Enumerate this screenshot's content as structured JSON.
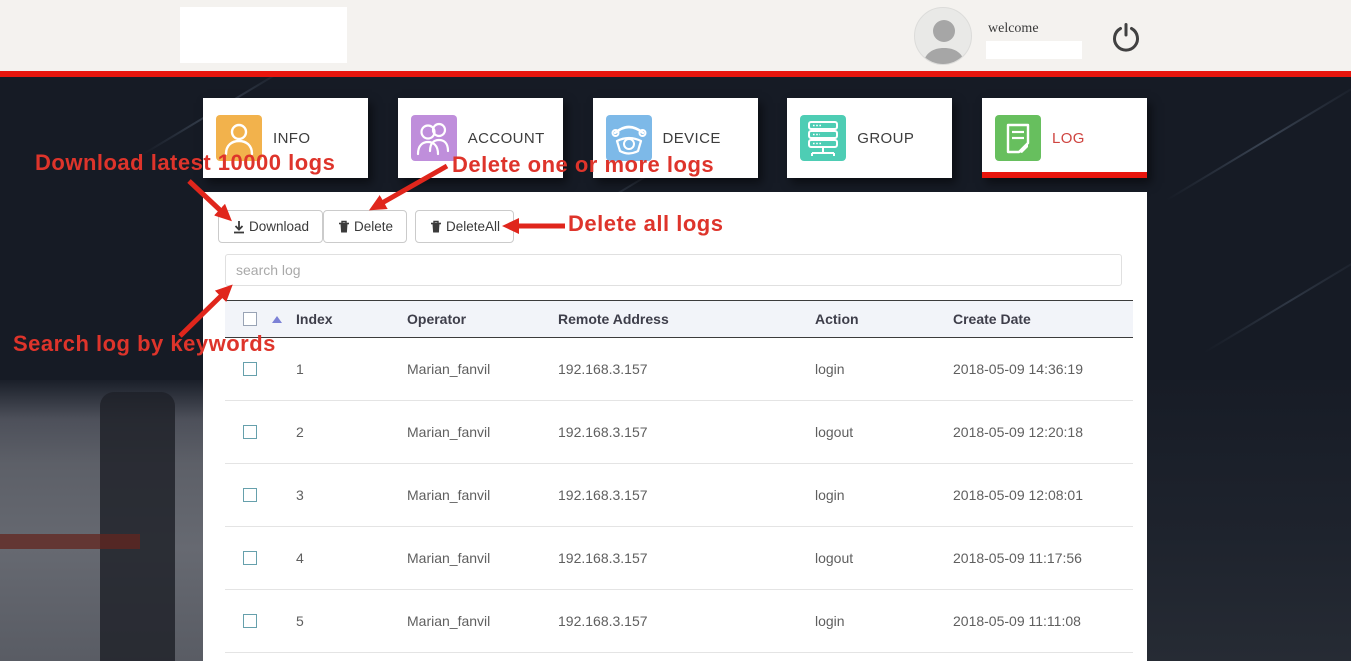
{
  "header": {
    "welcome": "welcome"
  },
  "tabs": [
    {
      "label": "INFO",
      "icon": "person-icon",
      "icon_color": "#f2b24c",
      "active": false
    },
    {
      "label": "ACCOUNT",
      "icon": "people-icon",
      "icon_color": "#bf8edb",
      "active": false
    },
    {
      "label": "DEVICE",
      "icon": "phone-icon",
      "icon_color": "#7db9e8",
      "active": false
    },
    {
      "label": "GROUP",
      "icon": "servers-icon",
      "icon_color": "#4ecdb4",
      "active": false
    },
    {
      "label": "LOG",
      "icon": "document-icon",
      "icon_color": "#67bf5e",
      "active": true
    }
  ],
  "toolbar": {
    "download": "Download",
    "delete": "Delete",
    "delete_all": "DeleteAll",
    "download_icon": "download-icon",
    "delete_icon": "trash-icon",
    "delete_all_icon": "trash-icon"
  },
  "search": {
    "placeholder": "search log"
  },
  "table": {
    "columns": [
      "Index",
      "Operator",
      "Remote Address",
      "Action",
      "Create Date"
    ],
    "rows": [
      {
        "index": "1",
        "operator": "Marian_fanvil",
        "remote_address": "192.168.3.157",
        "action": "login",
        "create_date": "2018-05-09 14:36:19"
      },
      {
        "index": "2",
        "operator": "Marian_fanvil",
        "remote_address": "192.168.3.157",
        "action": "logout",
        "create_date": "2018-05-09 12:20:18"
      },
      {
        "index": "3",
        "operator": "Marian_fanvil",
        "remote_address": "192.168.3.157",
        "action": "login",
        "create_date": "2018-05-09 12:08:01"
      },
      {
        "index": "4",
        "operator": "Marian_fanvil",
        "remote_address": "192.168.3.157",
        "action": "logout",
        "create_date": "2018-05-09 11:17:56"
      },
      {
        "index": "5",
        "operator": "Marian_fanvil",
        "remote_address": "192.168.3.157",
        "action": "login",
        "create_date": "2018-05-09 11:11:08"
      }
    ]
  },
  "annotations": {
    "download": "Download latest 10000 logs",
    "delete": "Delete one or more logs",
    "delete_all": "Delete all logs",
    "search": "Search log by keywords"
  },
  "colors": {
    "accent_red": "#e8150d",
    "annotation_red": "#de342b",
    "tab_active_text": "#cf4440",
    "table_header_bg": "#f2f4f9"
  }
}
